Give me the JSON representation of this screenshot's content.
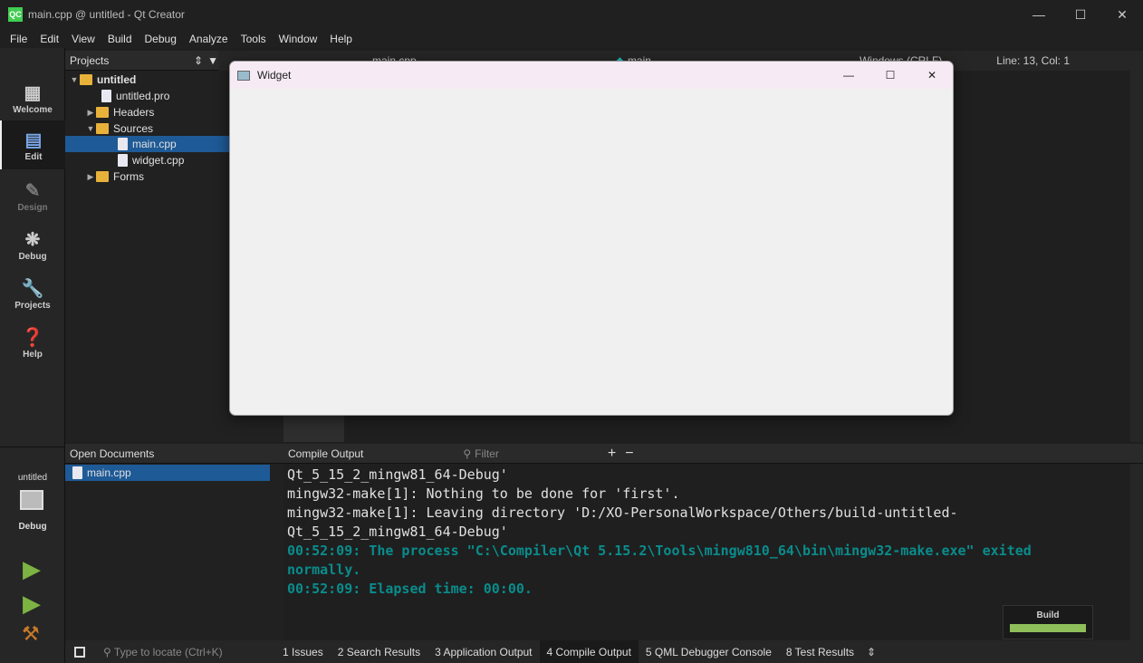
{
  "window": {
    "title": "main.cpp @ untitled - Qt Creator",
    "logo": "QC"
  },
  "menu": [
    "File",
    "Edit",
    "View",
    "Build",
    "Debug",
    "Analyze",
    "Tools",
    "Window",
    "Help"
  ],
  "modes": [
    {
      "label": "Welcome",
      "icon": "grid-icon"
    },
    {
      "label": "Edit",
      "icon": "document-icon"
    },
    {
      "label": "Design",
      "icon": "pencil-icon"
    },
    {
      "label": "Debug",
      "icon": "bug-icon"
    },
    {
      "label": "Projects",
      "icon": "wrench-icon"
    },
    {
      "label": "Help",
      "icon": "help-icon"
    }
  ],
  "kit": {
    "project": "untitled",
    "config": "Debug"
  },
  "projects_pane": {
    "title": "Projects",
    "tree": [
      "untitled",
      "untitled.pro",
      "Headers",
      "Sources",
      "main.cpp",
      "widget.cpp",
      "Forms"
    ]
  },
  "editor_toolbar": {
    "file": "main.cpp",
    "symbol": "main",
    "line_ending": "Windows (CRLF)",
    "position": "Line: 13, Col: 1"
  },
  "widget_window": {
    "title": "Widget"
  },
  "open_documents": {
    "title": "Open Documents",
    "items": [
      "main.cpp"
    ]
  },
  "output_pane": {
    "title": "Compile Output",
    "filter_placeholder": "Filter",
    "lines": [
      "Qt_5_15_2_mingw81_64-Debug'",
      "mingw32-make[1]: Nothing to be done for 'first'.",
      "mingw32-make[1]: Leaving directory 'D:/XO-PersonalWorkspace/Others/build-untitled-",
      "Qt_5_15_2_mingw81_64-Debug'"
    ],
    "highlight_lines": [
      "00:52:09: The process \"C:\\Compiler\\Qt 5.15.2\\Tools\\mingw810_64\\bin\\mingw32-make.exe\" exited",
      "normally.",
      "00:52:09: Elapsed time: 00:00."
    ]
  },
  "locator": {
    "placeholder": "Type to locate (Ctrl+K)"
  },
  "output_tabs": [
    "1  Issues",
    "2  Search Results",
    "3  Application Output",
    "4  Compile Output",
    "5  QML Debugger Console",
    "8  Test Results"
  ],
  "build_progress": {
    "label": "Build",
    "value": 1.0,
    "color": "#8fbf5a"
  }
}
